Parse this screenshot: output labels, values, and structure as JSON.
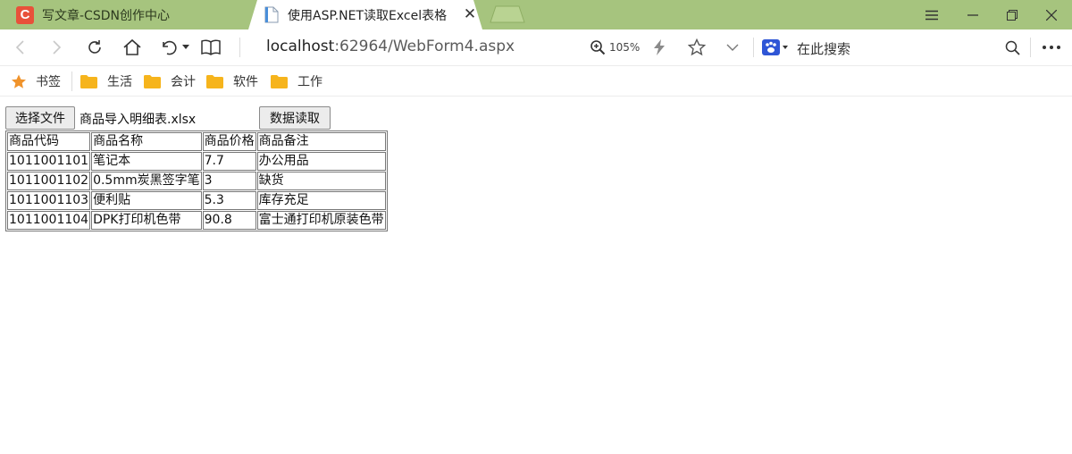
{
  "tabs": [
    {
      "title": "写文章-CSDN创作中心",
      "icon": "csdn-logo",
      "icon_text": "C",
      "active": false
    },
    {
      "title": "使用ASP.NET读取Excel表格",
      "icon": "document-icon",
      "active": true
    }
  ],
  "toolbar": {
    "url_host": "localhost",
    "url_rest": ":62964/WebForm4.aspx",
    "zoom": "105%",
    "search_placeholder": "在此搜索"
  },
  "bookmarks": {
    "star_label": "书签",
    "folders": [
      "生活",
      "会计",
      "软件",
      "工作"
    ]
  },
  "page": {
    "choose_file_label": "选择文件",
    "selected_file": "商品导入明细表.xlsx",
    "read_button_label": "数据读取",
    "table": {
      "headers": [
        "商品代码",
        "商品名称",
        "商品价格",
        "商品备注"
      ],
      "rows": [
        [
          "1011001101",
          "笔记本",
          "7.7",
          "办公用品"
        ],
        [
          "1011001102",
          "0.5mm炭黑签字笔",
          "3",
          "缺货"
        ],
        [
          "1011001103",
          "便利贴",
          "5.3",
          "库存充足"
        ],
        [
          "1011001104",
          "DPK打印机色带",
          "90.8",
          "富士通打印机原装色带"
        ]
      ]
    }
  },
  "colors": {
    "tabbar": "#a6c47e",
    "csdn": "#e8513a",
    "folder": "#f6b41c",
    "star": "#f0932b"
  }
}
